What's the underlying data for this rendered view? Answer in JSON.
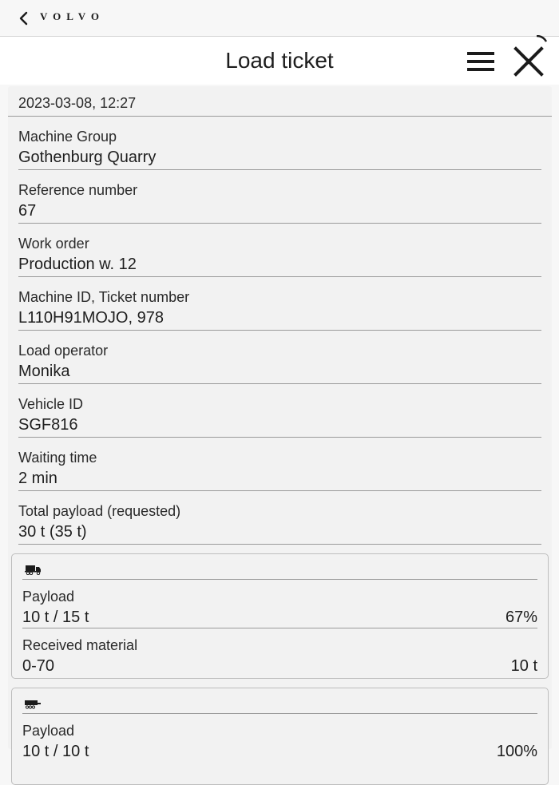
{
  "header": {
    "brand": "VOLVO"
  },
  "title": "Load ticket",
  "date": "2023-03-08, 12:27",
  "fields": [
    {
      "label": "Machine Group",
      "value": "Gothenburg Quarry"
    },
    {
      "label": "Reference number",
      "value": "67"
    },
    {
      "label": "Work order",
      "value": "Production w. 12"
    },
    {
      "label": "Machine ID, Ticket number",
      "value": "L110H91MOJO, 978"
    },
    {
      "label": "Load operator",
      "value": "Monika"
    },
    {
      "label": "Vehicle ID",
      "value": "SGF816"
    },
    {
      "label": "Waiting time",
      "value": "2 min"
    },
    {
      "label": "Total payload (requested)",
      "value": "30 t (35 t)"
    }
  ],
  "trucks": [
    {
      "icon": "dump-truck-icon",
      "payload_label": "Payload",
      "payload_value": "10 t / 15 t",
      "payload_percent": "67%",
      "material_label": "Received material",
      "material_value": "0-70",
      "material_weight": "10 t"
    },
    {
      "icon": "trailer-icon",
      "payload_label": "Payload",
      "payload_value": "10 t / 10 t",
      "payload_percent": "100%"
    }
  ]
}
